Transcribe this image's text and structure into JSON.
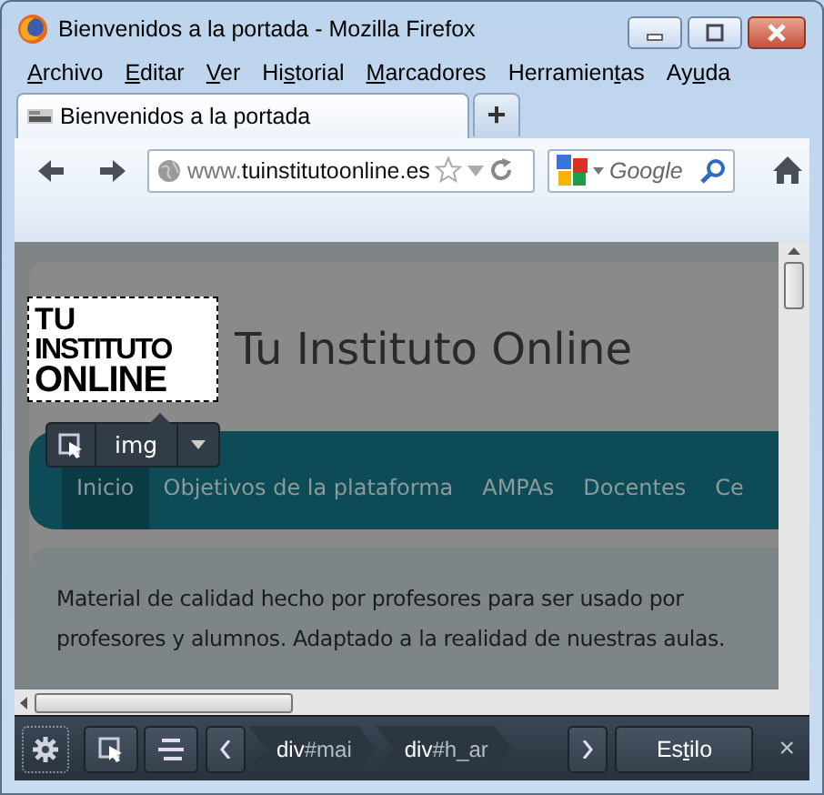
{
  "window": {
    "title": "Bienvenidos a la portada - Mozilla Firefox"
  },
  "menu": [
    {
      "key": "A",
      "after": "rchivo"
    },
    {
      "key": "E",
      "after": "ditar"
    },
    {
      "key": "V",
      "after": "er"
    },
    {
      "before": "Hi",
      "key": "s",
      "after": "torial"
    },
    {
      "key": "M",
      "after": "arcadores"
    },
    {
      "before": "Herramien",
      "key": "t",
      "after": "as"
    },
    {
      "before": "Ay",
      "key": "u",
      "after": "da"
    }
  ],
  "tabs": [
    {
      "label": "Bienvenidos a la portada",
      "selected": true
    }
  ],
  "new_tab": "+",
  "toolbar": {
    "url_prefix": "www.",
    "url_host": "tuinstitutoonline.es",
    "search_placeholder": "Google"
  },
  "page": {
    "logo_lines": [
      "TU",
      "INSTITUTO",
      "ONLINE"
    ],
    "site_title": "Tu Instituto Online",
    "nav": [
      {
        "label": "Inicio",
        "selected": true
      },
      {
        "label": "Objetivos de la plataforma",
        "selected": false
      },
      {
        "label": "AMPAs",
        "selected": false
      },
      {
        "label": "Docentes",
        "selected": false
      },
      {
        "label": "Ce",
        "selected": false
      }
    ],
    "body": "Material de calidad hecho por profesores para ser usado por profesores y alumnos. Adaptado a la realidad de nuestras aulas."
  },
  "inspector": {
    "infobar_tag": "img",
    "breadcrumbs": [
      {
        "tag": "div",
        "id": "#mai"
      },
      {
        "tag": "div",
        "id": "#h_ar"
      }
    ],
    "style_button": {
      "before": "Es",
      "key": "t",
      "after": "ilo"
    },
    "close": "×"
  }
}
